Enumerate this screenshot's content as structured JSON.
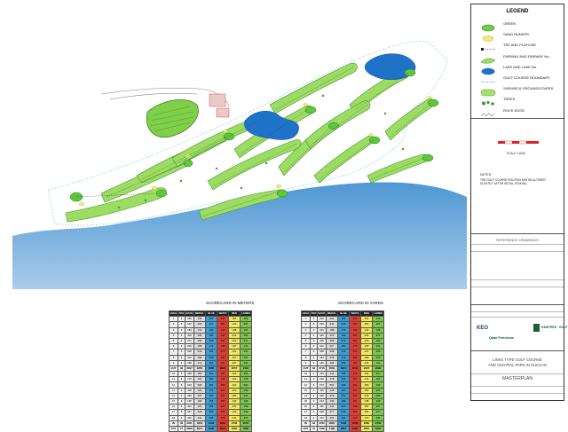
{
  "legend": {
    "title": "LEGEND",
    "items": [
      {
        "label": "GREEN",
        "icon": "green-patch-icon",
        "color": "#6fcf3f"
      },
      {
        "label": "SAND BUNKER",
        "icon": "sand-bunker-icon",
        "color": "#f3e97a"
      },
      {
        "label": "TEE AND PLAYLINE",
        "icon": "tee-playline-icon",
        "color": "#222222"
      },
      {
        "label": "FAIRWAY AND FAIRWAY No.",
        "icon": "fairway-icon",
        "color": "#9ddc63"
      },
      {
        "label": "LAKE AND LAKE No.",
        "icon": "lake-icon",
        "color": "#1e73c8"
      },
      {
        "label": "GOLF COURSE BOUNDARY",
        "icon": "boundary-line-icon",
        "color": "#5aa8d8"
      },
      {
        "label": "SHRUBS & GROUNDCOVERS",
        "icon": "shrubs-icon",
        "color": "#a7dd6a"
      },
      {
        "label": "TREES",
        "icon": "trees-icon",
        "color": "#3f9a2e"
      },
      {
        "label": "ROCK EDGE",
        "icon": "rock-edge-icon",
        "color": "#888888"
      }
    ]
  },
  "scale": {
    "label": "SCALE 1:8000"
  },
  "notes": {
    "label": "NOTES:",
    "text": "THE GOLF COURSE ROUTING MAY BE ALTERED SLIGHTLY AFTER INITIAL STAKING."
  },
  "reference": {
    "label": "REFERENCE DRAWINGS"
  },
  "logos": {
    "left": "KEO",
    "right": "HAWTREE · GOLF",
    "client": "Qatar Petroleum"
  },
  "project": {
    "line1": "LINKS TYPE GOLF COURSE",
    "line2": "AND CENTRAL PARK IN DUKHAN",
    "title": "MASTERPLAN"
  },
  "scorecards": [
    {
      "title": "SCORECARD IN METERS",
      "header": [
        "HOLE",
        "PAR",
        "BACK",
        "MEDAL",
        "BLUE",
        "WHITE",
        "RED",
        "LADIES"
      ],
      "rows": [
        [
          "1",
          "4",
          "383",
          "368",
          "351",
          "335",
          "305",
          "286"
        ],
        [
          "2",
          "5",
          "512",
          "496",
          "471",
          "450",
          "413",
          "387"
        ],
        [
          "3",
          "3",
          "184",
          "172",
          "160",
          "146",
          "128",
          "115"
        ],
        [
          "4",
          "4",
          "402",
          "384",
          "365",
          "348",
          "316",
          "294"
        ],
        [
          "5",
          "4",
          "371",
          "356",
          "339",
          "322",
          "293",
          "271"
        ],
        [
          "6",
          "3",
          "203",
          "189",
          "174",
          "158",
          "137",
          "121"
        ],
        [
          "7",
          "5",
          "538",
          "519",
          "493",
          "470",
          "431",
          "402"
        ],
        [
          "8",
          "4",
          "415",
          "398",
          "378",
          "360",
          "327",
          "304"
        ],
        [
          "9",
          "4",
          "389",
          "373",
          "355",
          "337",
          "307",
          "284"
        ],
        [
          "OUT",
          "36",
          "3397",
          "3255",
          "3086",
          "2926",
          "2657",
          "2464"
        ],
        [
          "10",
          "4",
          "396",
          "380",
          "361",
          "344",
          "313",
          "290"
        ],
        [
          "11",
          "3",
          "176",
          "164",
          "152",
          "139",
          "121",
          "108"
        ],
        [
          "12",
          "5",
          "524",
          "506",
          "481",
          "459",
          "421",
          "393"
        ],
        [
          "13",
          "4",
          "408",
          "391",
          "372",
          "354",
          "322",
          "298"
        ],
        [
          "14",
          "4",
          "362",
          "347",
          "330",
          "314",
          "286",
          "264"
        ],
        [
          "15",
          "3",
          "195",
          "182",
          "168",
          "153",
          "133",
          "118"
        ],
        [
          "16",
          "4",
          "421",
          "404",
          "384",
          "365",
          "332",
          "308"
        ],
        [
          "17",
          "5",
          "547",
          "528",
          "502",
          "478",
          "439",
          "409"
        ],
        [
          "18",
          "4",
          "432",
          "414",
          "394",
          "375",
          "341",
          "316"
        ],
        [
          "IN",
          "36",
          "3461",
          "3316",
          "3144",
          "2981",
          "2708",
          "2504"
        ],
        [
          "TOT",
          "72",
          "6858",
          "6571",
          "6230",
          "5907",
          "5365",
          "4968"
        ]
      ]
    },
    {
      "title": "SCORECARD IN YARDS",
      "header": [
        "HOLE",
        "PAR",
        "BACK",
        "MEDAL",
        "BLUE",
        "WHITE",
        "RED",
        "LADIES"
      ],
      "rows": [
        [
          "1",
          "4",
          "419",
          "402",
          "384",
          "366",
          "334",
          "313"
        ],
        [
          "2",
          "5",
          "560",
          "542",
          "515",
          "492",
          "452",
          "423"
        ],
        [
          "3",
          "3",
          "201",
          "188",
          "175",
          "160",
          "140",
          "126"
        ],
        [
          "4",
          "4",
          "440",
          "420",
          "399",
          "381",
          "346",
          "322"
        ],
        [
          "5",
          "4",
          "406",
          "389",
          "371",
          "352",
          "320",
          "296"
        ],
        [
          "6",
          "3",
          "222",
          "207",
          "190",
          "173",
          "150",
          "132"
        ],
        [
          "7",
          "5",
          "588",
          "568",
          "539",
          "514",
          "471",
          "440"
        ],
        [
          "8",
          "4",
          "454",
          "435",
          "413",
          "394",
          "358",
          "332"
        ],
        [
          "9",
          "4",
          "425",
          "408",
          "388",
          "369",
          "336",
          "311"
        ],
        [
          "OUT",
          "36",
          "3715",
          "3559",
          "3374",
          "3201",
          "2907",
          "2695"
        ],
        [
          "10",
          "4",
          "433",
          "416",
          "395",
          "376",
          "342",
          "317"
        ],
        [
          "11",
          "3",
          "192",
          "179",
          "166",
          "152",
          "132",
          "118"
        ],
        [
          "12",
          "5",
          "573",
          "553",
          "526",
          "502",
          "460",
          "430"
        ],
        [
          "13",
          "4",
          "446",
          "428",
          "407",
          "387",
          "352",
          "326"
        ],
        [
          "14",
          "4",
          "396",
          "379",
          "361",
          "343",
          "313",
          "289"
        ],
        [
          "15",
          "3",
          "213",
          "199",
          "184",
          "167",
          "145",
          "129"
        ],
        [
          "16",
          "4",
          "460",
          "442",
          "420",
          "399",
          "363",
          "337"
        ],
        [
          "17",
          "5",
          "598",
          "577",
          "549",
          "523",
          "480",
          "447"
        ],
        [
          "18",
          "4",
          "472",
          "453",
          "431",
          "410",
          "373",
          "346"
        ],
        [
          "IN",
          "36",
          "3783",
          "3626",
          "3439",
          "3259",
          "2960",
          "2739"
        ],
        [
          "TOT",
          "72",
          "7498",
          "7185",
          "6813",
          "6460",
          "5867",
          "5434"
        ]
      ]
    }
  ]
}
